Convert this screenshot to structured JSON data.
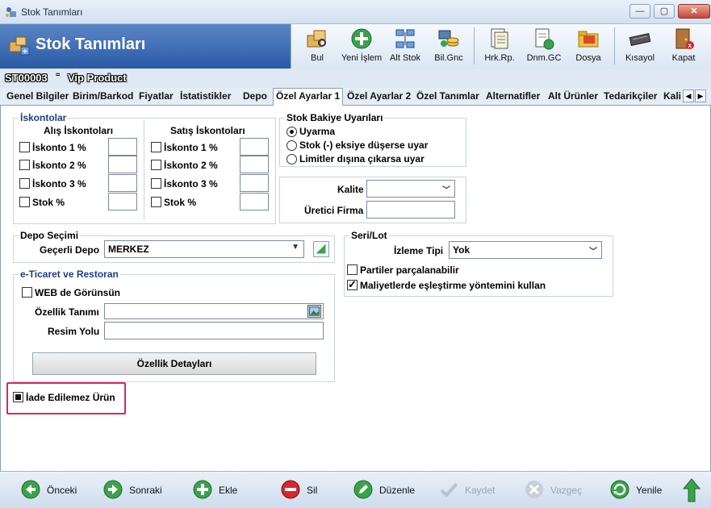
{
  "window": {
    "title": "Stok Tanımları",
    "min": "▭",
    "max": "▢",
    "close": "✕"
  },
  "header": {
    "title": "Stok Tanımları"
  },
  "toolbar": {
    "buttons": [
      {
        "label": "Bul",
        "icon": "search-box-icon"
      },
      {
        "label": "Yeni İşlem",
        "icon": "add-icon"
      },
      {
        "label": "Alt Stok",
        "icon": "network-icon"
      },
      {
        "label": "Bil.Gnc",
        "icon": "refresh-coins-icon"
      },
      {
        "label": "Hrk.Rp.",
        "icon": "report-icon"
      },
      {
        "label": "Dnm.GC",
        "icon": "document-refresh-icon"
      },
      {
        "label": "Dosya",
        "icon": "folder-icon"
      },
      {
        "label": "Kısayol",
        "icon": "keyboard-icon"
      },
      {
        "label": "Kapat",
        "icon": "exit-door-icon"
      }
    ]
  },
  "record": {
    "code": "ST00003",
    "separator": "-",
    "name": "Vip Product"
  },
  "tabs": [
    "Genel Bilgiler",
    "Birim/Barkod",
    "Fiyatlar",
    "İstatistikler",
    "Depo",
    "Özel Ayarlar 1",
    "Özel Ayarlar 2",
    "Özel Tanımlar",
    "Alternatifler",
    "Alt Ürünler",
    "Tedarikçiler",
    "Kali"
  ],
  "active_tab": "Özel Ayarlar 1",
  "iskontolar": {
    "title": "İskontolar",
    "alis_title": "Alış İskontoları",
    "satis_title": "Satış İskontoları",
    "alis_items": [
      "İskonto 1 %",
      "İskonto 2 %",
      "İskonto 3 %",
      "Stok %"
    ],
    "satis_items": [
      "İskonto 1 %",
      "İskonto 2 %",
      "İskonto 3 %",
      "Stok %"
    ]
  },
  "stok_bakiye": {
    "title": "Stok Bakiye Uyarıları",
    "options": [
      "Uyarma",
      "Stok (-) eksiye düşerse uyar",
      "Limitler dışına çıkarsa uyar"
    ],
    "selected": "Uyarma"
  },
  "kalite": {
    "kalite_label": "Kalite",
    "kalite_value": "",
    "uretici_label": "Üretici Firma",
    "uretici_value": ""
  },
  "depo": {
    "title": "Depo Seçimi",
    "label": "Geçerli Depo",
    "value": "MERKEZ"
  },
  "seri_lot": {
    "title": "Seri/Lot",
    "izleme_label": "İzleme Tipi",
    "izleme_value": "Yok",
    "partiler_label": "Partiler parçalanabilir",
    "partiler_checked": false,
    "maliyet_label": "Maliyetlerde eşleştirme yöntemini kullan",
    "maliyet_checked": true
  },
  "eticaret": {
    "title": "e-Ticaret ve Restoran",
    "web_label": "WEB de Görünsün",
    "ozellik_label": "Özellik Tanımı",
    "ozellik_value": "",
    "resim_label": "Resim Yolu",
    "resim_value": "",
    "detay_button": "Özellik Detayları"
  },
  "iade": {
    "label": "İade Edilemez Ürün",
    "state": "indeterminate"
  },
  "bottom": {
    "buttons": [
      {
        "label": "Önceki",
        "icon": "arrow-left-icon",
        "enabled": true,
        "color": "#3aa34a"
      },
      {
        "label": "Sonraki",
        "icon": "arrow-right-icon",
        "enabled": true,
        "color": "#3aa34a"
      },
      {
        "label": "Ekle",
        "icon": "plus-icon",
        "enabled": true,
        "color": "#3aa34a"
      },
      {
        "label": "Sil",
        "icon": "minus-icon",
        "enabled": true,
        "color": "#d8262b"
      },
      {
        "label": "Düzenle",
        "icon": "edit-icon",
        "enabled": true,
        "color": "#3aa34a"
      },
      {
        "label": "Kaydet",
        "icon": "check-icon",
        "enabled": false,
        "color": "#b9c3cf"
      },
      {
        "label": "Vazgeç",
        "icon": "cancel-icon",
        "enabled": false,
        "color": "#b9c3cf"
      },
      {
        "label": "Yenile",
        "icon": "refresh-icon",
        "enabled": true,
        "color": "#3aa34a"
      }
    ],
    "up_icon": "arrow-up-icon"
  }
}
